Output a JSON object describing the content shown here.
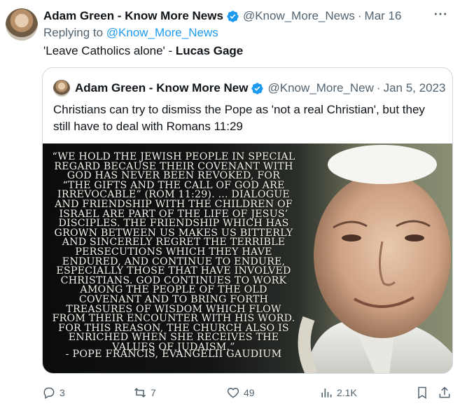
{
  "tweet": {
    "author_name": "Adam Green - Know More News",
    "handle": "@Know_More_News",
    "separator": "·",
    "date": "Mar 16",
    "replying_prefix": "Replying to",
    "replying_to": "@Know_More_News",
    "text_main": "'Leave Catholics alone' - ",
    "text_bold": "Lucas Gage"
  },
  "quoted": {
    "author_name": "Adam Green - Know More New",
    "handle": "@Know_More_New",
    "separator": "·",
    "date": "Jan 5, 2023",
    "text": "Christians can try to dismiss the Pope as 'not a real Christian', but they still have to deal with Romans 11:29",
    "image": {
      "quote_text": "“We hold the Jewish people in special regard because their covenant with God has never been revoked, for “the gifts and the call of God are irrevocable” (Rom 11:29). ... Dialogue and friendship with the children of Israel are part of the life of Jesus’ disciples. The friendship which has grown between us makes us bitterly and sincerely regret the terrible persecutions which they have endured, and continue to endure, especially those that have involved Christians. God continues to work among the people of the Old Covenant and to bring forth treasures of wisdom which flow from their encounter with his word. For this reason, the Church also is enriched when she receives the values of Judaism.”",
      "attribution": "- Pope Francis, Evangelii Gaudium"
    }
  },
  "actions": {
    "replies": "3",
    "reposts": "7",
    "likes": "49",
    "views": "2.1K"
  },
  "colors": {
    "verified": "#1d9bf0",
    "link": "#1d9bf0",
    "muted": "#536471",
    "text": "#0f1419",
    "border": "#cfd9de"
  },
  "icons": [
    "verified-badge-icon",
    "more-icon",
    "reply-icon",
    "repost-icon",
    "like-icon",
    "views-icon",
    "bookmark-icon",
    "share-icon"
  ]
}
